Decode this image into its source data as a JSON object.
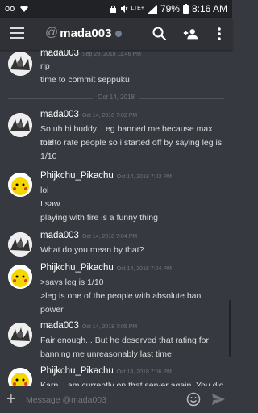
{
  "status_bar": {
    "battery_pct": "79%",
    "time": "8:16 AM",
    "network": "LTE+"
  },
  "header": {
    "at_symbol": "@",
    "channel_name": "mada003",
    "presence": "offline"
  },
  "colors": {
    "background": "#36393f",
    "header": "#2f3136",
    "statusbar": "#202225",
    "timestamp": "#72767d"
  },
  "messages": [
    {
      "author": "mada003",
      "timestamp": "Sep 29, 2018 11:46 PM",
      "lines": [
        "rip",
        "time to commit seppuku"
      ]
    },
    {
      "divider": "Oct 14, 2018"
    },
    {
      "author": "mada003",
      "timestamp": "Oct 14, 2018 7:02 PM",
      "lines": [
        "So uh hi buddy. Leg banned me because max told",
        "me to rate people so i started off by saying leg is",
        "1/10"
      ]
    },
    {
      "author": "Phijkchu_Pikachu",
      "timestamp": "Oct 14, 2018 7:03 PM",
      "lines": [
        "lol",
        "I saw",
        "playing with fire is a funny thing"
      ]
    },
    {
      "author": "mada003",
      "timestamp": "Oct 14, 2018 7:04 PM",
      "lines": [
        "What do you mean by that?"
      ]
    },
    {
      "author": "Phijkchu_Pikachu",
      "timestamp": "Oct 14, 2018 7:04 PM",
      "lines": [
        ">says leg is 1/10",
        ">leg is one of the people with absolute ban",
        "power"
      ]
    },
    {
      "author": "mada003",
      "timestamp": "Oct 14, 2018 7:05 PM",
      "lines": [
        "Fair enough... But he deserved that rating for",
        "banning me unreasonably last  time"
      ]
    },
    {
      "author": "Phijkchu_Pikachu",
      "timestamp": "Oct 14, 2018 7:06 PM",
      "lines": [
        "Karp, I am currently on that server again. You did"
      ]
    }
  ],
  "input": {
    "placeholder": "Message @mada003"
  },
  "icons": {
    "menu": "hamburger-icon",
    "search": "search-icon",
    "add_friend": "add-user-icon",
    "more": "more-vertical-icon",
    "plus": "plus-icon",
    "emoji": "emoji-icon",
    "send": "send-icon"
  }
}
